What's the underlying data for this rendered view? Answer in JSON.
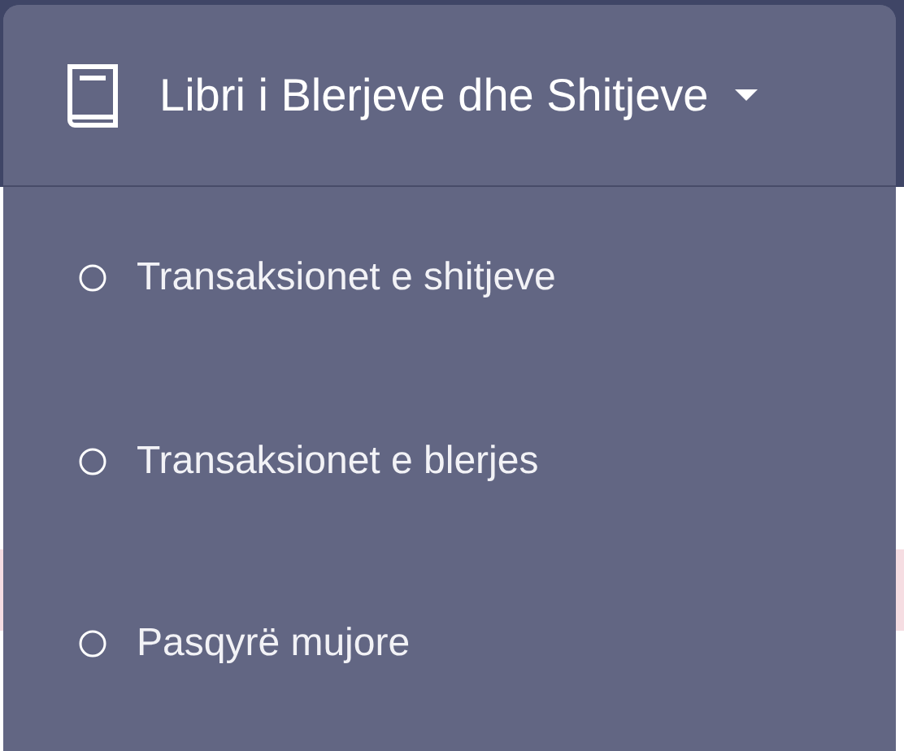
{
  "menu": {
    "title": "Libri i Blerjeve dhe Shitjeve",
    "expanded": true,
    "items": [
      {
        "label": "Transaksionet e shitjeve"
      },
      {
        "label": "Transaksionet e blerjes"
      },
      {
        "label": "Pasqyrë mujore"
      }
    ]
  }
}
